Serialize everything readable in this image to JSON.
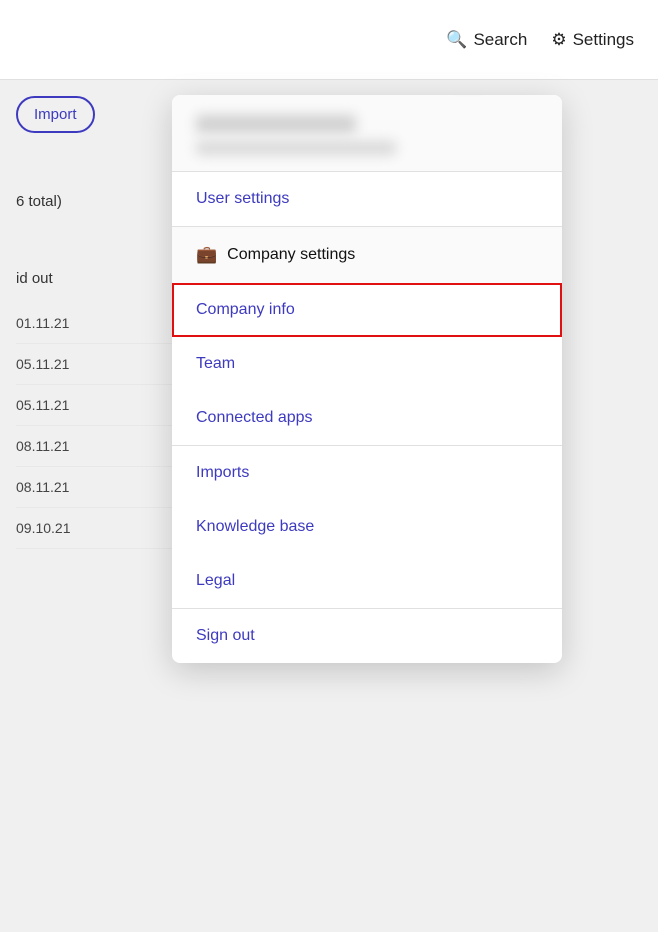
{
  "topbar": {
    "search_label": "Search",
    "settings_label": "Settings",
    "search_icon": "🔍",
    "settings_icon": "⚙"
  },
  "background": {
    "button_label": "Import",
    "total_text": "6 total)",
    "paid_text": "id out",
    "dates": [
      "01.11.21",
      "05.11.21",
      "05.11.21",
      "08.11.21",
      "08.11.21",
      "09.10.21"
    ]
  },
  "dropdown": {
    "user_section": {
      "name_placeholder": "",
      "email_placeholder": ""
    },
    "user_settings_label": "User settings",
    "company_settings_section": {
      "header_label": "Company settings",
      "icon": "💼"
    },
    "menu_items": [
      {
        "id": "company-info",
        "label": "Company info",
        "active": true
      },
      {
        "id": "team",
        "label": "Team",
        "active": false
      },
      {
        "id": "connected-apps",
        "label": "Connected apps",
        "active": false
      },
      {
        "id": "imports",
        "label": "Imports",
        "active": false
      },
      {
        "id": "knowledge-base",
        "label": "Knowledge base",
        "active": false
      },
      {
        "id": "legal",
        "label": "Legal",
        "active": false
      }
    ],
    "sign_out_label": "Sign out"
  }
}
